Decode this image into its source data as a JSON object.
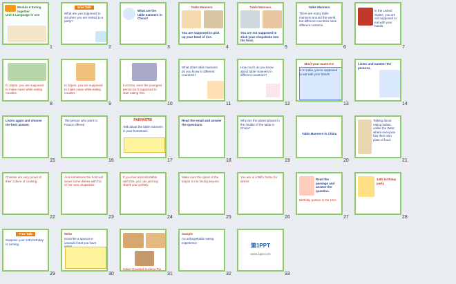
{
  "slides": [
    {
      "n": "1",
      "title": "Module 6 Eating together",
      "sub": "Unit 3 Language in use"
    },
    {
      "n": "2",
      "title": "Free Talk",
      "sub": "What are you supposed to do when you are invited to a party?"
    },
    {
      "n": "3",
      "title": "What are the table manners in China?",
      "sub": ""
    },
    {
      "n": "4",
      "title": "Table Manners",
      "sub": "You are supposed to pick up your bowl of rice."
    },
    {
      "n": "5",
      "title": "Table Manners",
      "sub": "You are not supposed to stick your chopsticks into the food."
    },
    {
      "n": "6",
      "title": "Table Manners",
      "sub": "There are many table manners around the world, but different countries have different customs."
    },
    {
      "n": "7",
      "title": "",
      "sub": "In the United States, you are not supposed to eat with your hands."
    },
    {
      "n": "8",
      "title": "",
      "sub": "In Japan, you are supposed to make noise while eating noodles."
    },
    {
      "n": "9",
      "title": "",
      "sub": "In Japan, you are supposed to make noise while eating noodles."
    },
    {
      "n": "10",
      "title": "",
      "sub": "In Korea, even the youngest person isn't supposed to start eating first."
    },
    {
      "n": "11",
      "title": "",
      "sub": "What other table manners do you know in different countries?"
    },
    {
      "n": "12",
      "title": "",
      "sub": "How much do you know about table manners in different countries?"
    },
    {
      "n": "13",
      "title": "Mind your manners!",
      "sub": "1. In India, you're supposed to eat with your hands."
    },
    {
      "n": "14",
      "title": "Listen and number the pictures.",
      "sub": ""
    },
    {
      "n": "15",
      "title": "Listen again and choose the best answer.",
      "sub": ""
    },
    {
      "n": "16",
      "title": "",
      "sub": "The person who went to France offered"
    },
    {
      "n": "17",
      "title": "PAIRWORK",
      "sub": "Talk about the table manners in your hometown."
    },
    {
      "n": "18",
      "title": "Read the email and answer the questions.",
      "sub": ""
    },
    {
      "n": "19",
      "title": "",
      "sub": "Why are the plates placed in the middle of the table in China?"
    },
    {
      "n": "20",
      "title": "Table Manners in China",
      "sub": ""
    },
    {
      "n": "21",
      "title": "",
      "sub": "Talking about eating habits, unlike the West where everyone has their own plate of food."
    },
    {
      "n": "22",
      "title": "",
      "sub": "Chinese are very proud of their culture of cooking."
    },
    {
      "n": "23",
      "title": "",
      "sub": "And sometimes the host will serve some dishes with his or her own chopsticks."
    },
    {
      "n": "24",
      "title": "",
      "sub": "If you feel uncomfortable with this, you can just say 'thank you' politely."
    },
    {
      "n": "25",
      "title": "",
      "sub": "Make sure the spout of the teapot is not facing anyone."
    },
    {
      "n": "26",
      "title": "",
      "sub": "You are in a Bill's home for dinner."
    },
    {
      "n": "27",
      "title": "Read the passage and answer the question.",
      "sub": "Birthday parties in the USA"
    },
    {
      "n": "28",
      "title": "14th birthday party",
      "sub": ""
    },
    {
      "n": "29",
      "title": "Free Talk",
      "sub": "Suppose your 14th birthday is coming."
    },
    {
      "n": "30",
      "title": "Write",
      "sub": "Describe a special or unusual meal you have eaten."
    },
    {
      "n": "31",
      "title": "",
      "sub": "Italian Roasted Sucking Pig"
    },
    {
      "n": "32",
      "title": "Sample",
      "sub": "An unforgettable eating experience"
    },
    {
      "n": "33",
      "title": "第1PPT",
      "sub": "www.1ppt.com"
    }
  ],
  "colors": {
    "frame": "#8ec96a",
    "title": "#1f3f8a",
    "accent": "#c0392b"
  }
}
